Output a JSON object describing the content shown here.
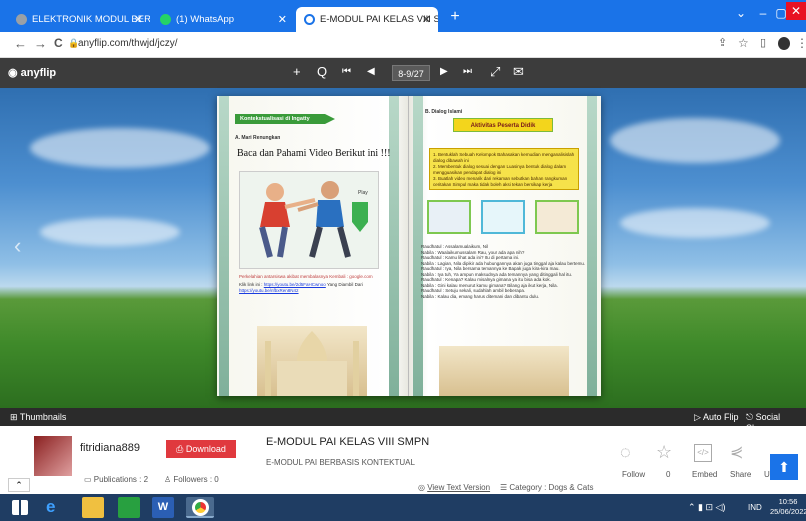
{
  "tabs": [
    {
      "label": "ELEKTRONIK MODUL BERBASIS K",
      "active": false,
      "color": "#5f6368"
    },
    {
      "label": "(1) WhatsApp",
      "active": false,
      "color": "#25d366"
    },
    {
      "label": "E-MODUL PAI KELAS VIII SMPN",
      "active": true,
      "color": "#1a73e8"
    }
  ],
  "new_tab": "+",
  "window": {
    "min": "–",
    "max": "▢",
    "close": "✕",
    "down": "⌄"
  },
  "address": {
    "back": "←",
    "forward": "→",
    "reload": "C",
    "url": "anyflip.com/thwjd/jczy/"
  },
  "flip": {
    "logo": "anyflip",
    "page": "8-9/27",
    "zoom_in": "+",
    "search": "Q",
    "first": "⏮",
    "prev": "◀",
    "next": "▶",
    "last": "⏭",
    "fullscreen": "⤢",
    "mail": "✉"
  },
  "left_page": {
    "banner": "Kontekstualisasi di Ingatty",
    "section": "A. Mari Renungkan",
    "heading": "Baca dan Pahami Video Berikut ini !!!",
    "caption": "Perkelahian antarsiswa akibat membalasnya Kembali : google.com",
    "link_prefix": "Klik link ini : ",
    "link1": "https://youtu.be/2d5FaHCwnoo",
    "link_mid": " Yang Diambil Dari ",
    "link2": "https://youtu.be/nfbxRen8N42"
  },
  "right_page": {
    "section": "B. Dialog Islami",
    "banner": "Aktivitas Peserta Didik",
    "items": [
      "1. Bentuklah Sebuah Kelompok Bahasakan kemudian menganalisislah dialog dibawah ini",
      "2. Membentuk dialog sesuai dengan Luasinya bentuk dialog dalam mengguasikan pendapat dialog ini",
      "3. Buatlah video menarik dari rekaman sebutkan bahan rangkuman ceritakan Simpul maka tidak boleh aksi tekan bersikap kerja"
    ],
    "dialog": [
      "Raudhatul : Assalamualaikum, Nil",
      "Nabila : Waalaikumussalam Rau, your ada apa nih?",
      "Raudhatul : Kamu lihat ada ini? Itu di pertama ini.",
      "Nabila : Lagian, Nila dipikir ada hubungannya akan juga tinggal aja kalau bertemu.",
      "Raudhatul : Iya, Nila bersama temannya ke Bapak juga kira-kira mau.",
      "Nabila : Iya tuh, Ya ampun maksudnya ada temannya yang ditinggali hal itu.",
      "Raudhatul : Kenapa? Kalau misalnya gimana ya itu bisa ada kok.",
      "Nabila : Gini kalau menurut kamu gimana? Bilang aja ikut kerja, Nila.",
      "Raudhatul : Setuju sekali, sudahlah ambil beberapa.",
      "Nabila : Kalau dia, emang harus ditemani dan dibantu dulu."
    ]
  },
  "lower_toolbar": {
    "thumbnails": "Thumbnails",
    "auto_flip": "Auto Flip",
    "social_share": "Social Share"
  },
  "info": {
    "user": "fitridiana889",
    "download": "Download PDF",
    "publications": "Publications : 2",
    "followers": "Followers : 0",
    "title": "E-MODUL PAI KELAS VIII SMPN",
    "subtitle": "E-MODUL PAI BERBASIS KONTEKTUAL",
    "view_text": "View Text Version",
    "category": "Category : Dogs & Cats",
    "actions": {
      "follow": "Follow",
      "like_count": "0",
      "embed": "Embed",
      "share": "Share",
      "up": "Up"
    }
  },
  "taskbar": {
    "lang": "IND",
    "time": "10:56",
    "date": "25/06/2022"
  },
  "colors": {
    "tab_bar": "#1a73e8",
    "download": "#e0393e",
    "toolbar": "#3c3c3c"
  }
}
